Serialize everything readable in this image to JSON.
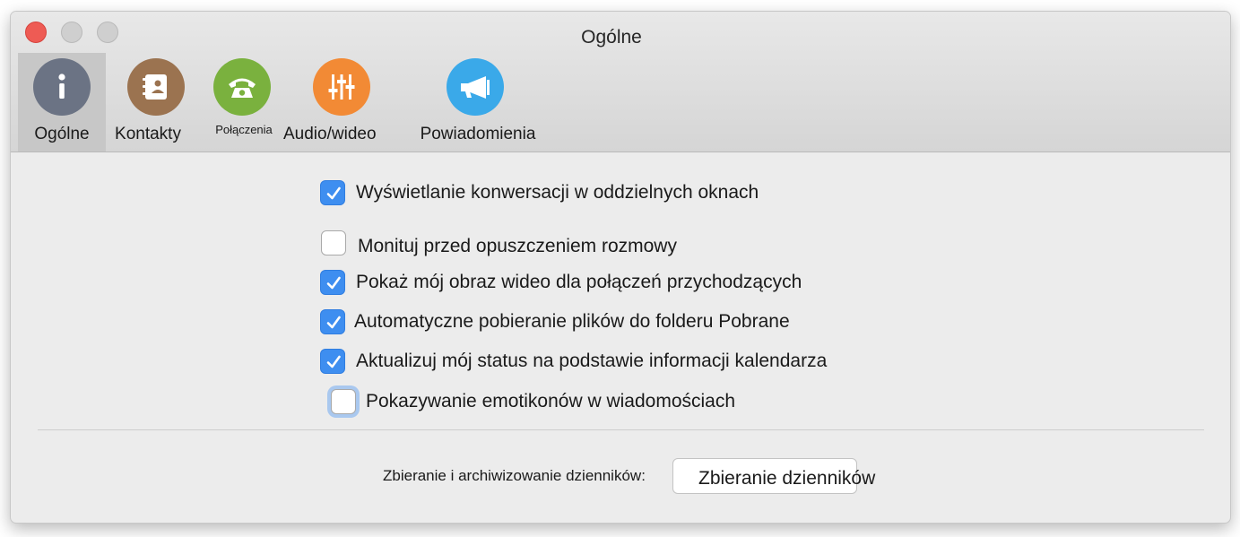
{
  "window": {
    "title": "Ogólne"
  },
  "tabs": [
    {
      "label": "Ogólne",
      "icon": "info-icon",
      "color": "#6b7384",
      "selected": true
    },
    {
      "label": "Kontakty",
      "icon": "contacts-book-icon",
      "color": "#9b7350",
      "selected": false
    },
    {
      "label": "Połączenia",
      "icon": "phone-icon",
      "color": "#7ab13e",
      "selected": false
    },
    {
      "label": "Audio/wideo",
      "icon": "sliders-icon",
      "color": "#f28a35",
      "selected": false
    },
    {
      "label": "Powiadomienia",
      "icon": "megaphone-icon",
      "color": "#3aa9e9",
      "selected": false
    }
  ],
  "options": [
    {
      "label": "Wyświetlanie konwersacji w oddzielnych oknach",
      "checked": true
    },
    {
      "label": "Monituj przed opuszczeniem rozmowy",
      "checked": false
    },
    {
      "label": "Pokaż mój obraz wideo dla połączeń przychodzących",
      "checked": true
    },
    {
      "label": "Automatyczne pobieranie plików do folderu Pobrane",
      "checked": true
    },
    {
      "label": "Aktualizuj mój status na podstawie informacji kalendarza",
      "checked": true
    },
    {
      "label": "Pokazywanie emotikonów w wiadomościach",
      "checked": false
    }
  ],
  "logs": {
    "label": "Zbieranie i archiwizowanie dzienników:",
    "button_label": "Zbieranie dzienników"
  },
  "colors": {
    "accent": "#3e8ef0",
    "close": "#ee5b54"
  }
}
